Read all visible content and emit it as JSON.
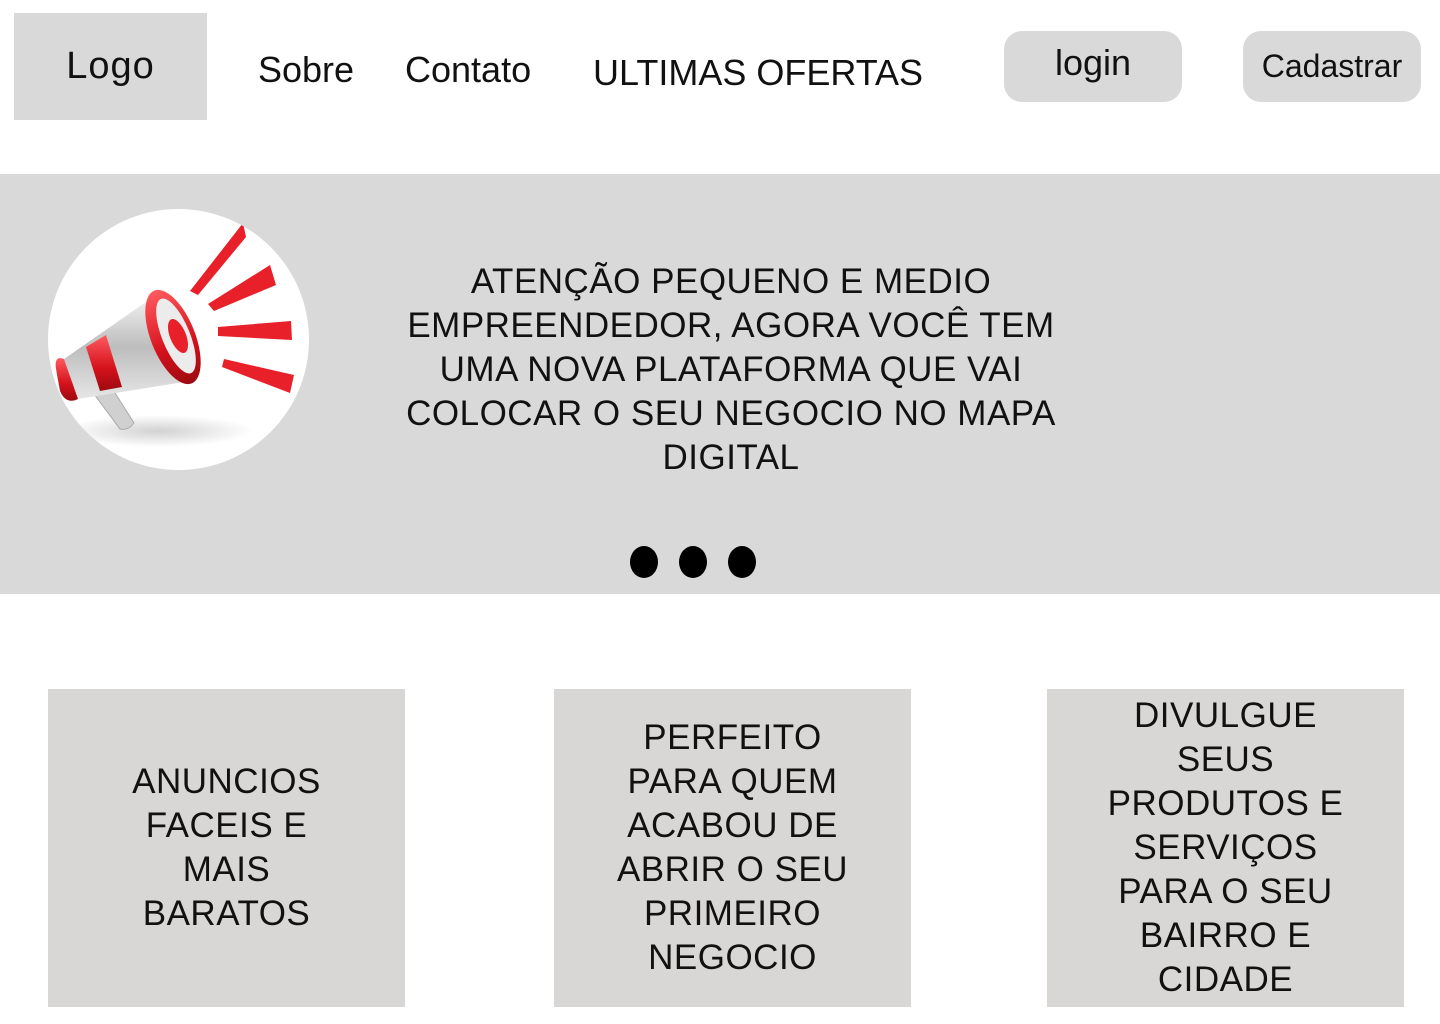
{
  "header": {
    "logo_label": "Logo",
    "nav": {
      "about": "Sobre",
      "contact": "Contato",
      "offers": "ULTIMAS OFERTAS"
    },
    "login_label": "login",
    "signup_label": "Cadastrar"
  },
  "hero": {
    "icon": "megaphone-icon",
    "message": "ATENÇÃO PEQUENO E MEDIO EMPREENDEDOR, AGORA VOCÊ TEM UMA NOVA PLATAFORMA QUE VAI COLOCAR O SEU NEGOCIO NO MAPA DIGITAL",
    "slide_count": 3
  },
  "features": [
    {
      "text": "ANUNCIOS FACEIS E MAIS BARATOS"
    },
    {
      "text": "PERFEITO PARA QUEM ACABOU DE ABRIR O SEU PRIMEIRO NEGOCIO"
    },
    {
      "text": "DIVULGUE SEUS PRODUTOS E SERVIÇOS PARA O SEU BAIRRO E CIDADE"
    }
  ],
  "colors": {
    "panel_gray": "#d9d9d9",
    "card_gray": "#d8d7d5",
    "accent_red": "#e8202a"
  }
}
